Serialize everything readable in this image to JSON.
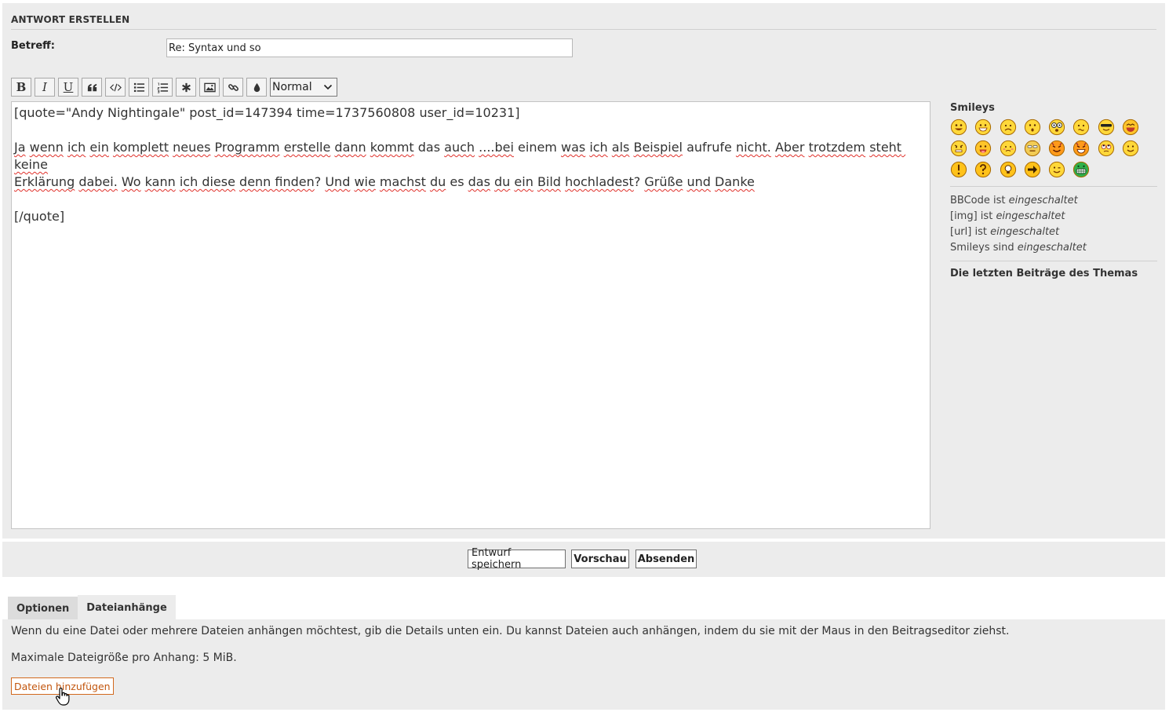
{
  "form": {
    "section_title": "ANTWORT ERSTELLEN",
    "subject_label": "Betreff:",
    "subject_value": "Re: Syntax und so"
  },
  "toolbar": {
    "buttons": [
      {
        "name": "bold",
        "icon": "bold-icon",
        "glyph": "B"
      },
      {
        "name": "italic",
        "icon": "italic-icon",
        "glyph": "I"
      },
      {
        "name": "underline",
        "icon": "underline-icon",
        "glyph": "U"
      },
      {
        "name": "quote",
        "icon": "quote-icon"
      },
      {
        "name": "code",
        "icon": "code-icon"
      },
      {
        "name": "list",
        "icon": "bulleted-list-icon"
      },
      {
        "name": "ordered-list",
        "icon": "numbered-list-icon"
      },
      {
        "name": "list-item",
        "icon": "asterisk-icon"
      },
      {
        "name": "image",
        "icon": "image-icon"
      },
      {
        "name": "link",
        "icon": "link-icon"
      },
      {
        "name": "color",
        "icon": "color-drop-icon"
      }
    ],
    "font_size_selected": "Normal"
  },
  "editor": {
    "line1": "[quote=\"Andy Nightingale\" post_id=147394 time=1737560808 user_id=10231]",
    "line4": "[/quote]"
  },
  "sidebar": {
    "smileys_title": "Smileys",
    "smileys": [
      "very-happy",
      "smile-wide",
      "sad",
      "surprised",
      "shocked",
      "confused",
      "cool",
      "laughing",
      "mad",
      "razz",
      "embarrassed",
      "neutral",
      "evil",
      "twisted-evil",
      "rolling-eyes",
      "smile",
      "exclaim",
      "question",
      "idea",
      "arrow",
      "wink",
      "green-grin"
    ],
    "bbcode_status": [
      {
        "label": "BBCode ist",
        "state": "eingeschaltet"
      },
      {
        "label": "[img] ist",
        "state": "eingeschaltet"
      },
      {
        "label": "[url] ist",
        "state": "eingeschaltet"
      },
      {
        "label": "Smileys sind",
        "state": "eingeschaltet"
      }
    ],
    "recent_posts_title": "Die letzten Beiträge des Themas"
  },
  "actions": {
    "save_draft": "Entwurf speichern",
    "preview": "Vorschau",
    "submit": "Absenden"
  },
  "tabs": {
    "options": "Optionen",
    "attachments": "Dateianhänge"
  },
  "attachments": {
    "info": "Wenn du eine Datei oder mehrere Dateien anhängen möchtest, gib die Details unten ein. Du kannst Dateien auch anhängen, indem du sie mit der Maus in den Beitragseditor ziehst.",
    "max_size": "Maximale Dateigröße pro Anhang: 5 MiB.",
    "add_files_label": "Dateien hinzufügen"
  },
  "colors": {
    "panel_bg": "#ececec",
    "accent_orange": "#c2560e",
    "spell_error": "#e0302a"
  }
}
